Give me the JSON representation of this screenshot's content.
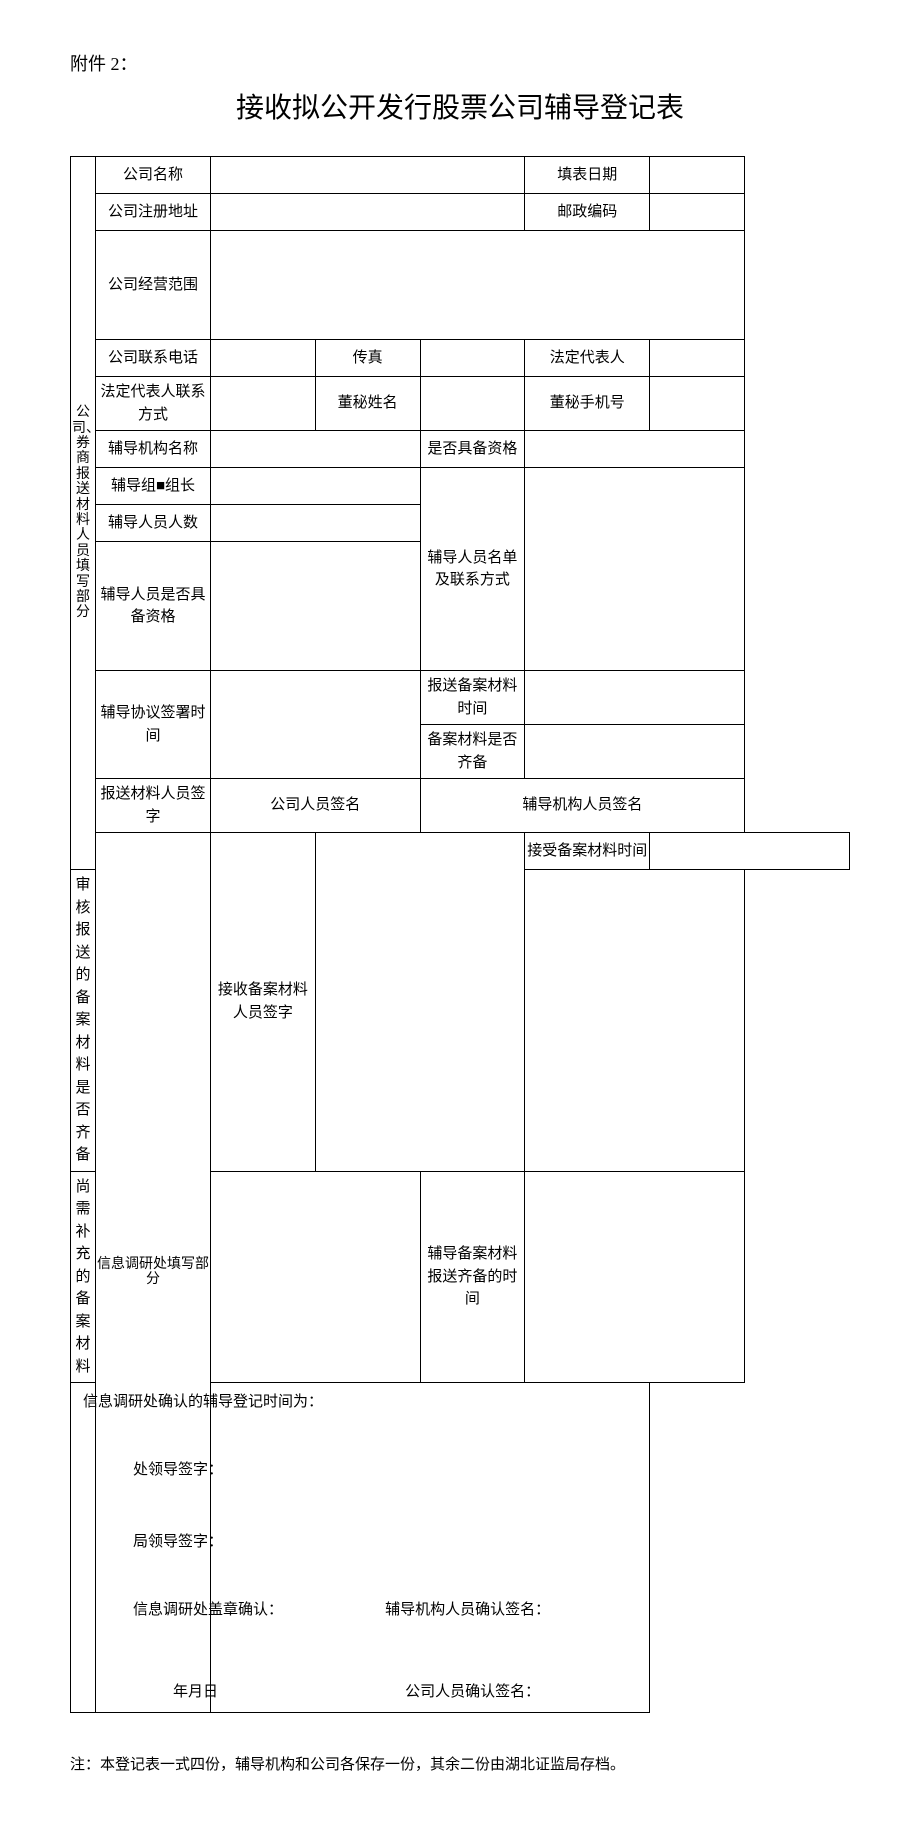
{
  "attachment_label": "附件 2：",
  "title": "接收拟公开发行股票公司辅导登记表",
  "section1_header": "公司、券商报送材料人员填写部分",
  "section2_header": "信息调研处填写部分",
  "row_company_name": "公司名称",
  "row_fill_date": "填表日期",
  "row_company_addr": "公司注册地址",
  "row_postcode": "邮政编码",
  "row_scope": "公司经营范围",
  "row_phone": "公司联系电话",
  "row_fax": "传真",
  "row_legal_rep": "法定代表人",
  "row_legal_contact": "法定代表人联系方式",
  "row_secretary_name": "董秘姓名",
  "row_secretary_phone": "董秘手机号",
  "row_guidance_org": "辅导机构名称",
  "row_qualified": "是否具备资格",
  "row_leader": "辅导组■组长",
  "row_staff_count": "辅导人员人数",
  "row_staff_list": "辅导人员名单及联系方式",
  "row_staff_qual": "辅导人员是否具备资格",
  "row_protocol_time": "辅导协议签署时间",
  "row_filing_time": "报送备案材料时间",
  "row_filing_complete": "备案材料是否齐备",
  "row_sender_sign": "报送材料人员签字",
  "row_company_sign": "公司人员签名",
  "row_org_sign": "辅导机构人员签名",
  "row_receiver_sign": "接收备案材料人员签字",
  "row_accept_time": "接受备案材料时间",
  "row_review_complete": "审核报送的备案材料是否齐备",
  "row_supplement": "尚需补充的备案材料",
  "row_complete_time": "辅导备案材料报送齐备的时间",
  "sig_confirm_time": "信息调研处确认的辅导登记时间为：",
  "sig_dept_leader": "处领导签字：",
  "sig_bureau_leader": "局领导签字：",
  "sig_dept_stamp": "信息调研处盖章确认：",
  "sig_org_confirm": "辅导机构人员确认签名：",
  "sig_date": "年月日",
  "sig_company_confirm": "公司人员确认签名：",
  "footnote": "注：本登记表一式四份，辅导机构和公司各保存一份，其余二份由湖北证监局存档。"
}
